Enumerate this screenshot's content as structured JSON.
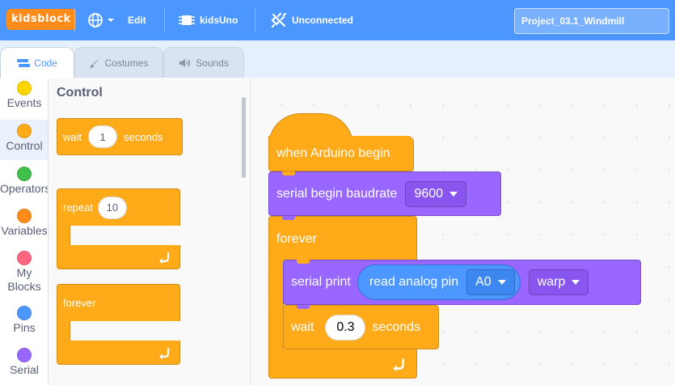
{
  "menubar": {
    "logo": "kidsblock",
    "edit": "Edit",
    "board": "kidsUno",
    "connection": "Unconnected",
    "project_title": "Project_03.1_Windmill"
  },
  "tabs": [
    {
      "label": "Code"
    },
    {
      "label": "Costumes"
    },
    {
      "label": "Sounds"
    }
  ],
  "categories": [
    {
      "label": "Events",
      "color": "#ffd500"
    },
    {
      "label": "Control",
      "color": "#ffab19"
    },
    {
      "label": "Operators",
      "color": "#40bf4a"
    },
    {
      "label": "Variables",
      "color": "#ff8c1a"
    },
    {
      "label": "My Blocks",
      "color": "#ff6680"
    },
    {
      "label": "Pins",
      "color": "#4c97ff"
    },
    {
      "label": "Serial",
      "color": "#9966ff"
    }
  ],
  "palette": {
    "title": "Control",
    "wait": {
      "pre": "wait",
      "value": "1",
      "post": "seconds"
    },
    "repeat": {
      "label": "repeat",
      "value": "10"
    },
    "forever": {
      "label": "forever"
    }
  },
  "script": {
    "hat": "when Arduino begin",
    "baud": {
      "label": "serial begin baudrate",
      "value": "9600"
    },
    "forever": "forever",
    "print": {
      "label": "serial print",
      "reporter": "read analog pin",
      "pin": "A0",
      "mode": "warp"
    },
    "wait": {
      "pre": "wait",
      "value": "0.3",
      "post": "seconds"
    }
  }
}
